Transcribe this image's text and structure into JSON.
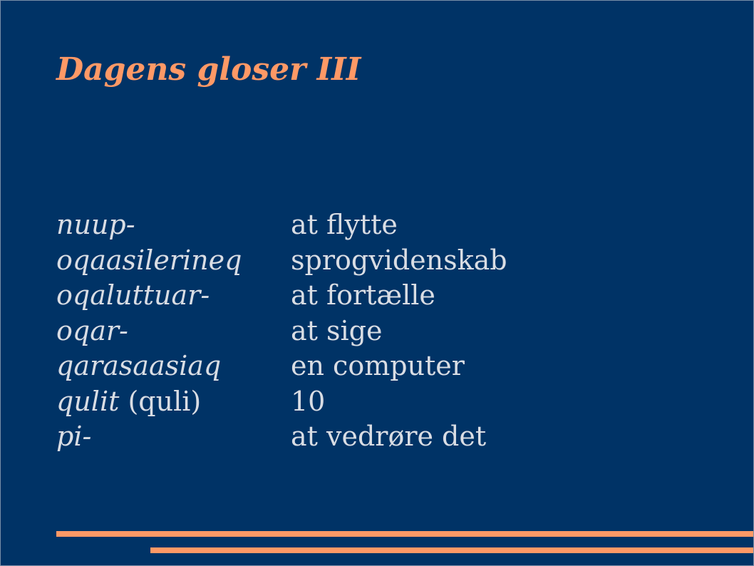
{
  "slide": {
    "title": "Dagens gloser III",
    "background_color": "#003366",
    "accent_color": "#ff9966",
    "text_color": "#d9dde4"
  },
  "glossary": [
    {
      "term": "nuup",
      "suffix": "-",
      "note": "",
      "definition": "at flytte"
    },
    {
      "term": "oqaasilerineq",
      "suffix": "",
      "note": "",
      "definition": "sprogvidenskab"
    },
    {
      "term": "oqaluttuar",
      "suffix": "-",
      "note": "",
      "definition": "at fortælle"
    },
    {
      "term": "oqar",
      "suffix": "-",
      "note": "",
      "definition": "at sige"
    },
    {
      "term": "qarasaasiaq",
      "suffix": "",
      "note": "",
      "definition": "en computer"
    },
    {
      "term": "qulit",
      "suffix": "",
      "note": " (quli)",
      "definition": "10"
    },
    {
      "term": "pi",
      "suffix": "-",
      "note": "",
      "definition": "at vedrøre det"
    }
  ]
}
